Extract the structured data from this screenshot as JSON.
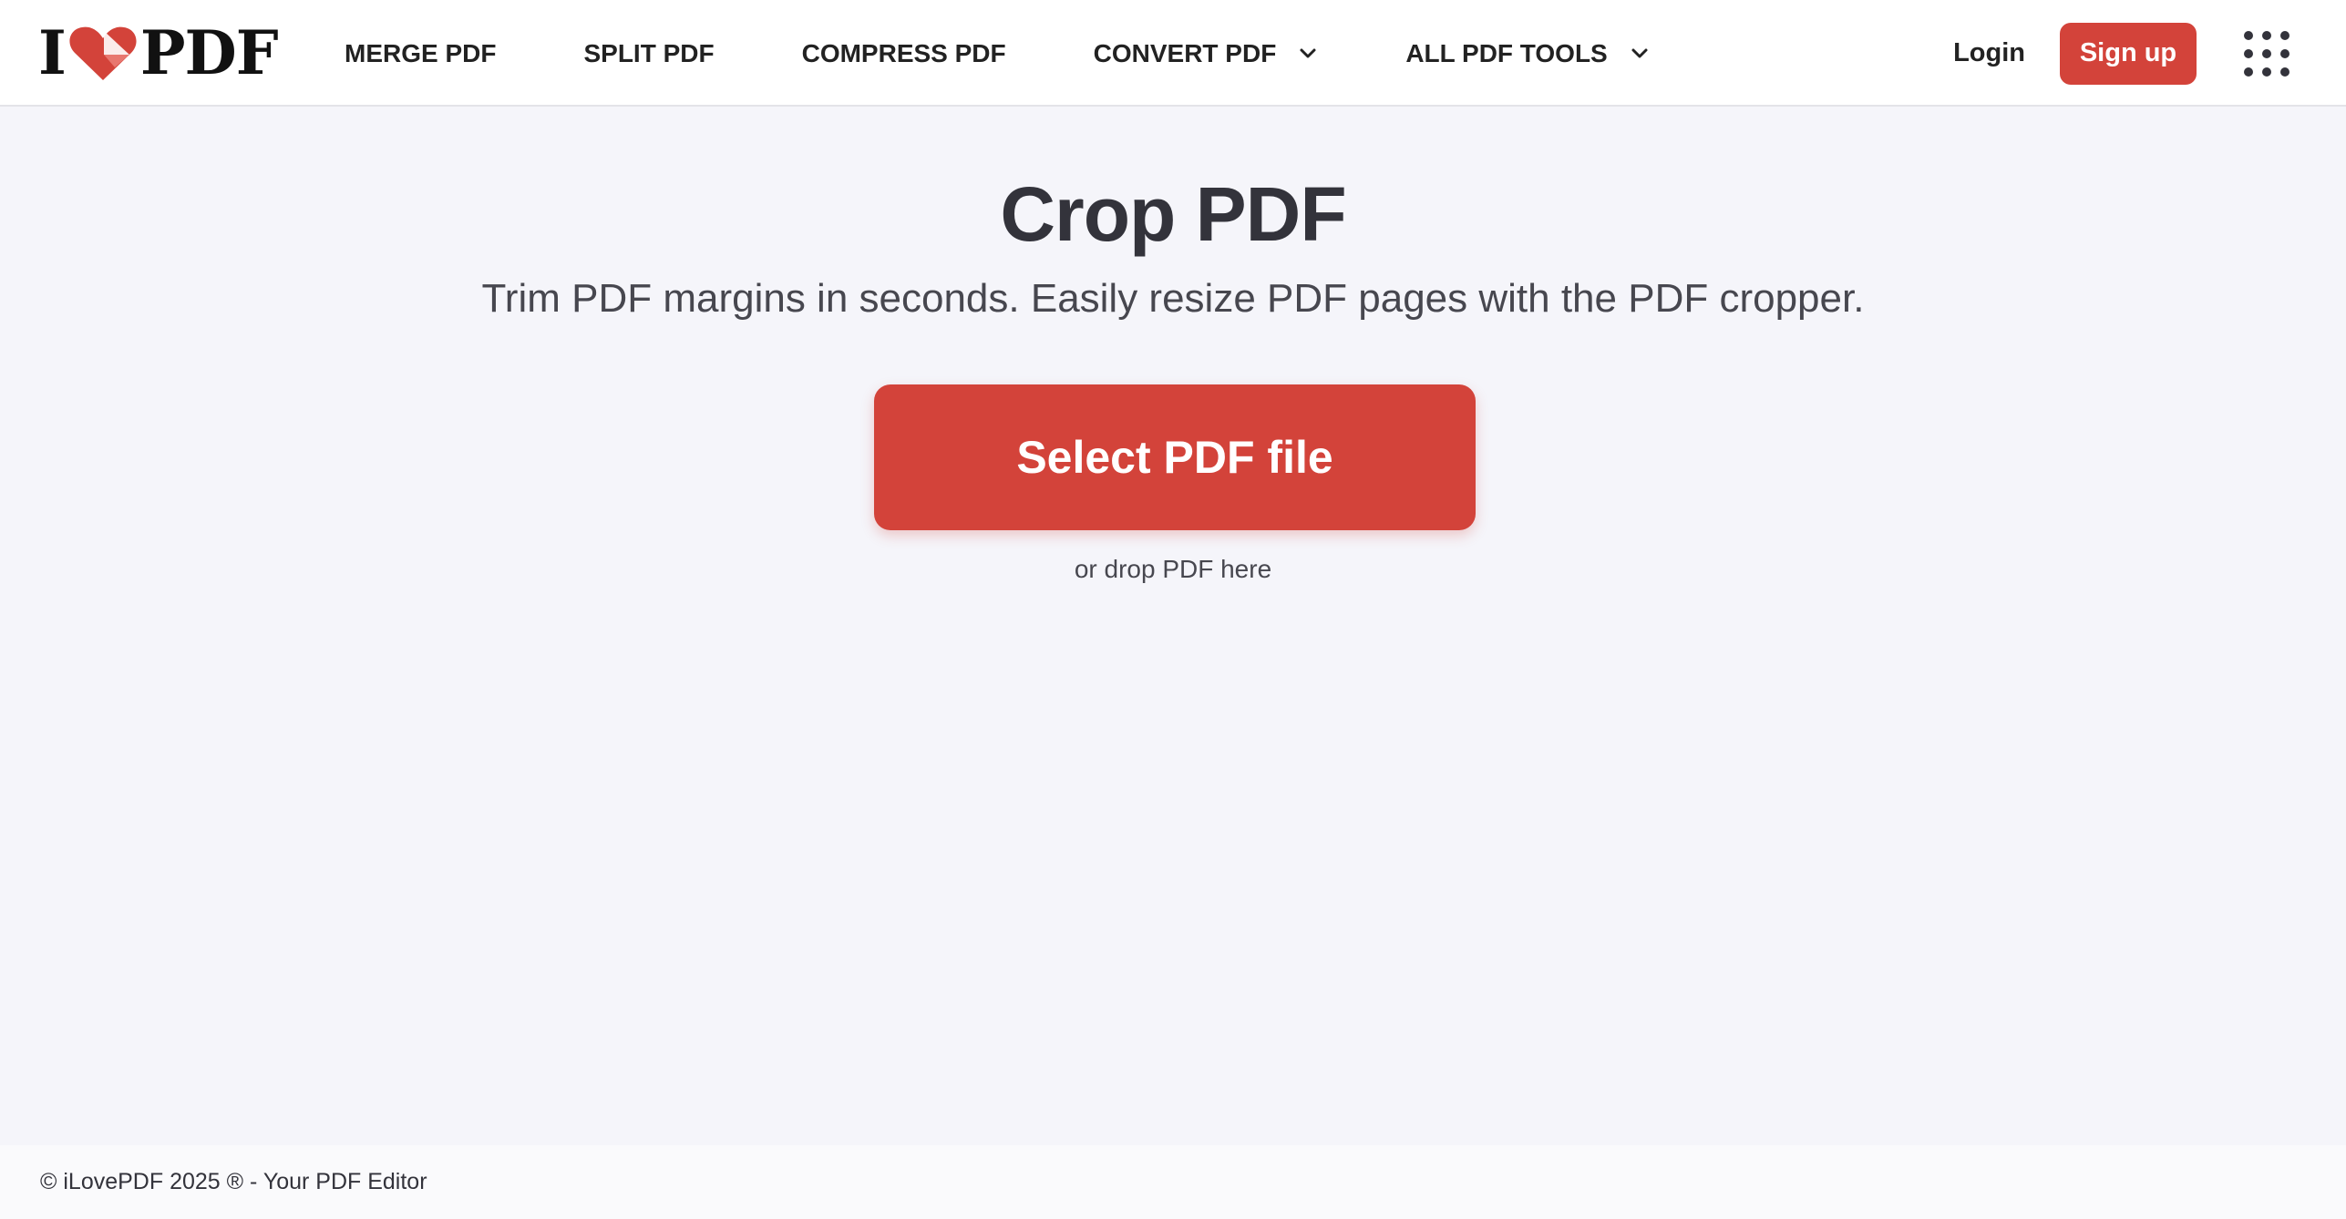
{
  "brand": {
    "logo_left": "I",
    "logo_right": "PDF",
    "accent_color": "#d3433a"
  },
  "nav": {
    "items": [
      {
        "label": "MERGE PDF",
        "has_dropdown": false
      },
      {
        "label": "SPLIT PDF",
        "has_dropdown": false
      },
      {
        "label": "COMPRESS PDF",
        "has_dropdown": false
      },
      {
        "label": "CONVERT PDF",
        "has_dropdown": true
      },
      {
        "label": "ALL PDF TOOLS",
        "has_dropdown": true
      }
    ]
  },
  "header": {
    "login_label": "Login",
    "signup_label": "Sign up",
    "apps_icon": "grid-apps-icon"
  },
  "main": {
    "title": "Crop PDF",
    "subtitle": "Trim PDF margins in seconds. Easily resize PDF pages with the PDF cropper.",
    "select_button_label": "Select PDF file",
    "drop_text": "or drop PDF here"
  },
  "footer": {
    "text": "© iLovePDF 2025 ® - Your PDF Editor"
  }
}
